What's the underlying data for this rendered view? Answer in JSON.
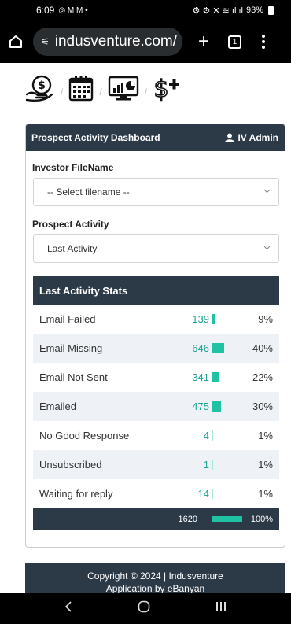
{
  "statusbar": {
    "time": "6:09",
    "left_icons": "◎ M M •",
    "battery": "93%"
  },
  "browser": {
    "url": "indusventure.com/",
    "tab_count": "1"
  },
  "card": {
    "title": "Prospect Activity Dashboard",
    "admin": "IV Admin",
    "investor_label": "Investor FileName",
    "investor_select": "-- Select filename --",
    "activity_label": "Prospect Activity",
    "activity_select": "Last Activity"
  },
  "stats": {
    "title": "Last Activity Stats",
    "rows": [
      {
        "name": "Email Failed",
        "count": "139",
        "pct": "9%",
        "fraction": 0.09
      },
      {
        "name": "Email Missing",
        "count": "646",
        "pct": "40%",
        "fraction": 0.4
      },
      {
        "name": "Email Not Sent",
        "count": "341",
        "pct": "22%",
        "fraction": 0.22
      },
      {
        "name": "Emailed",
        "count": "475",
        "pct": "30%",
        "fraction": 0.3
      },
      {
        "name": "No Good Response",
        "count": "4",
        "pct": "1%",
        "fraction": 0.01
      },
      {
        "name": "Unsubscribed",
        "count": "1",
        "pct": "1%",
        "fraction": 0.01
      },
      {
        "name": "Waiting for reply",
        "count": "14",
        "pct": "1%",
        "fraction": 0.01
      }
    ],
    "total": {
      "count": "1620",
      "pct": "100%"
    }
  },
  "footer": {
    "line1": "Copyright © 2024 | Indusventure",
    "line2": "Application by eBanyan"
  },
  "colors": {
    "header": "#2c3a48",
    "accent": "#1fc3a3",
    "accent_text": "#1fa58f",
    "row_alt": "#eef2f7"
  }
}
